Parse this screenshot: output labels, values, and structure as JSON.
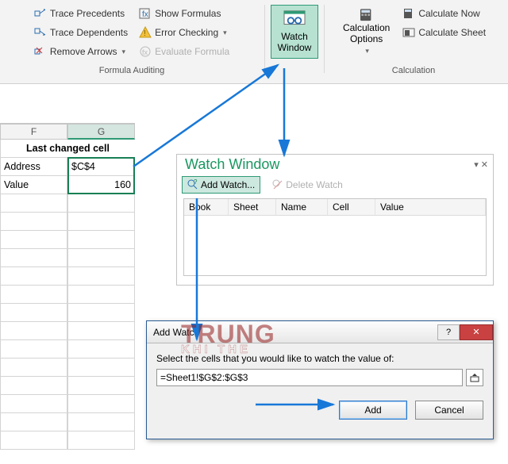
{
  "ribbon": {
    "formula_auditing": {
      "label": "Formula Auditing",
      "trace_precedents": "Trace Precedents",
      "trace_dependents": "Trace Dependents",
      "remove_arrows": "Remove Arrows",
      "show_formulas": "Show Formulas",
      "error_checking": "Error Checking",
      "evaluate_formula": "Evaluate Formula"
    },
    "watch_window": "Watch\nWindow",
    "calculation": {
      "label": "Calculation",
      "options": "Calculation\nOptions",
      "calc_now": "Calculate Now",
      "calc_sheet": "Calculate Sheet"
    }
  },
  "sheet": {
    "col_f": "F",
    "col_g": "G",
    "header": "Last changed cell",
    "address_label": "Address",
    "address_value": "$C$4",
    "value_label": "Value",
    "value_value": "160"
  },
  "watch_pane": {
    "title": "Watch Window",
    "add_watch": "Add Watch...",
    "delete_watch": "Delete Watch",
    "cols": {
      "book": "Book",
      "sheet": "Sheet",
      "name": "Name",
      "cell": "Cell",
      "value": "Value"
    }
  },
  "dialog": {
    "title": "Add Watch",
    "prompt": "Select the cells that you would like to watch the value of:",
    "input": "=Sheet1!$G$2:$G$3",
    "add": "Add",
    "cancel": "Cancel"
  },
  "watermark": {
    "main": "TRUNG",
    "sub": "KHI THE"
  }
}
